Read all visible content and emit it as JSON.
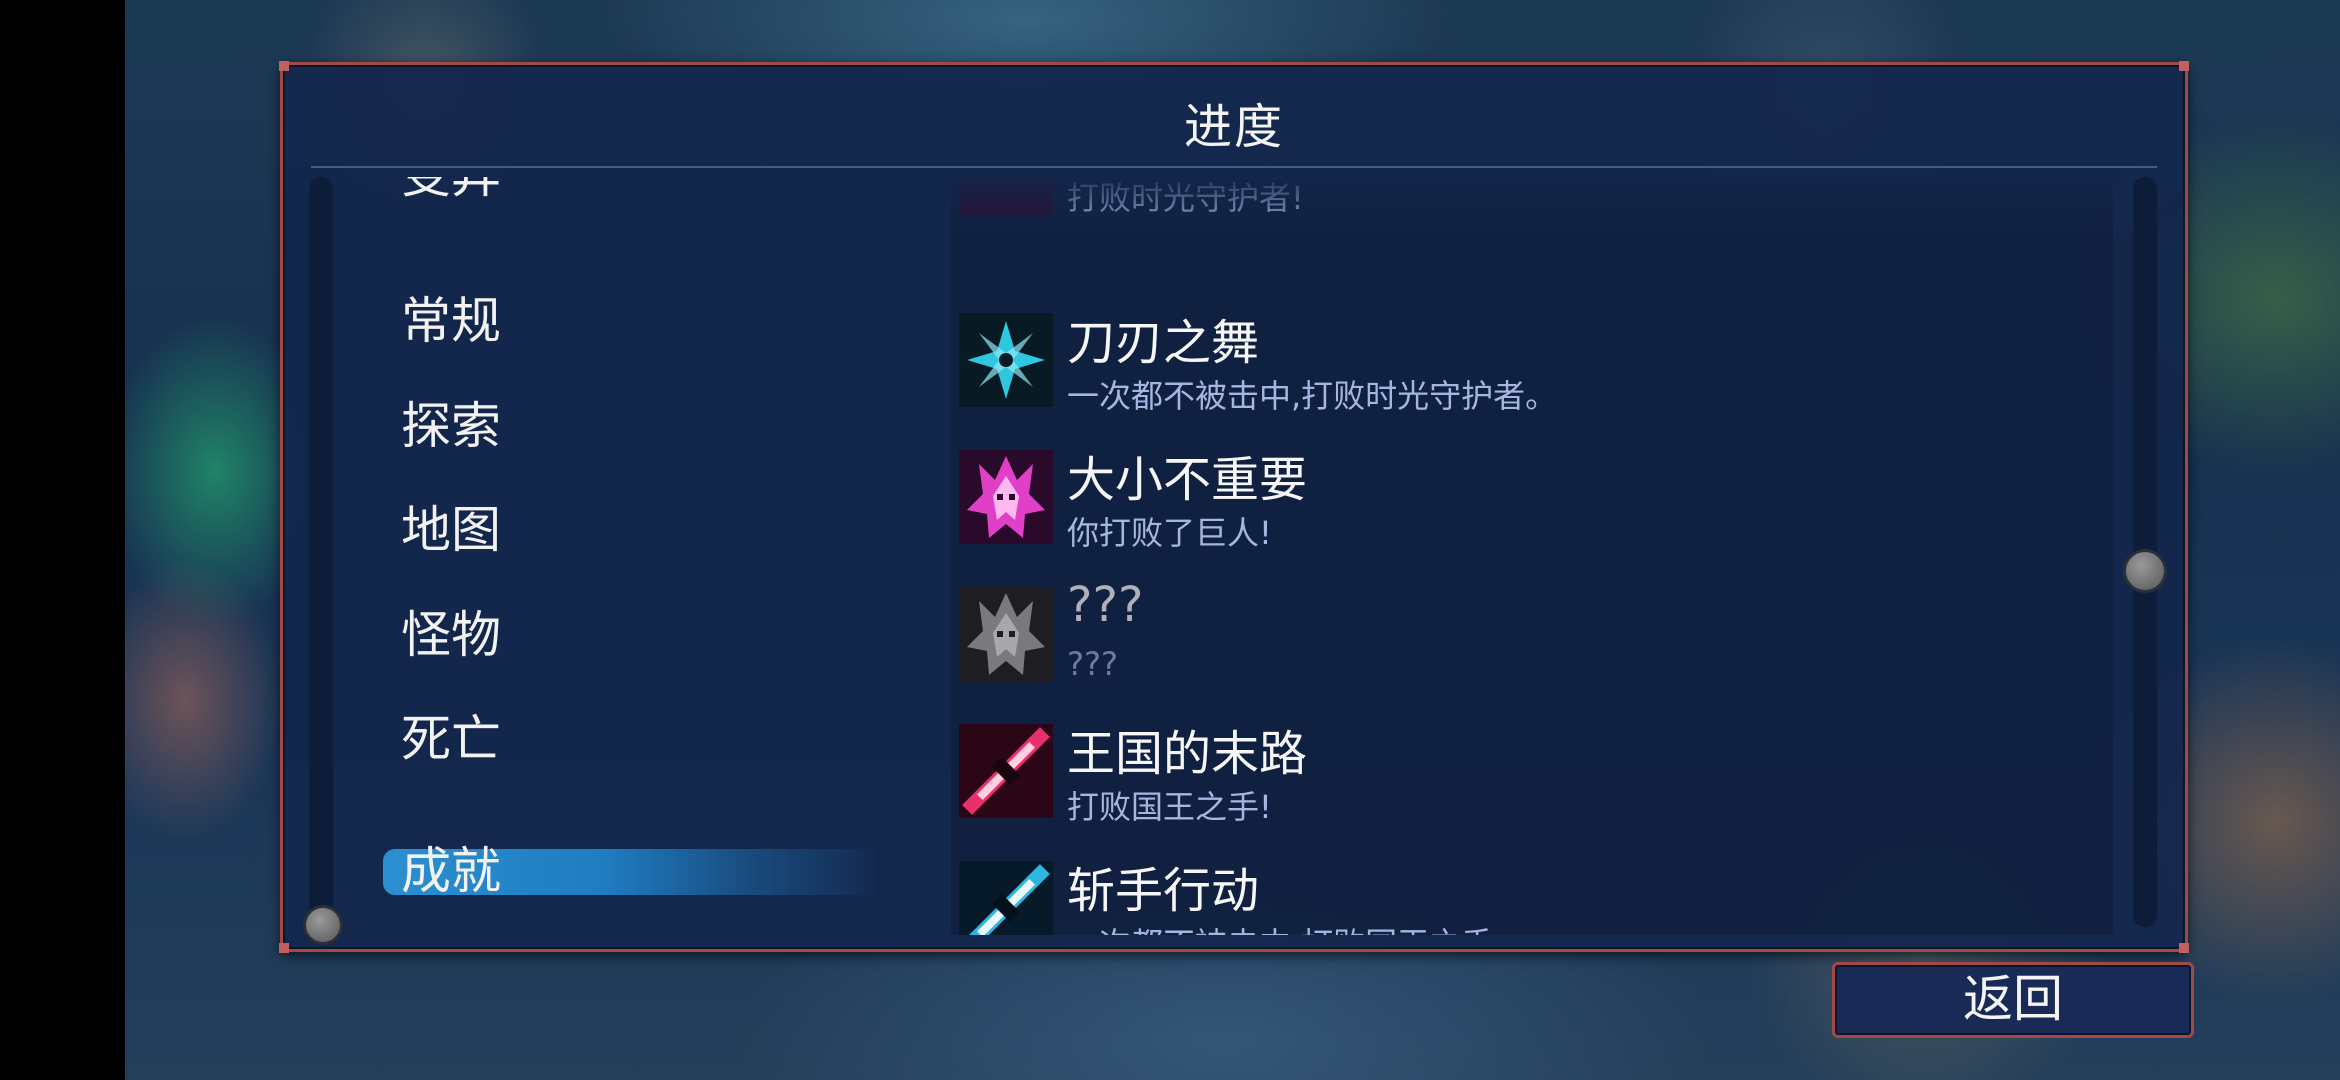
{
  "panel": {
    "title": "进度"
  },
  "categories": {
    "partial_top": "变异",
    "items": [
      "常规",
      "探索",
      "地图",
      "怪物",
      "死亡"
    ],
    "selected": "成就"
  },
  "achievements": {
    "partial_top_desc": "打败时光守护者!",
    "items": [
      {
        "name": "刀刃之舞",
        "desc": "一次都不被击中,打败时光守护者。",
        "icon": "shuriken-icon",
        "color": "#2fc6e0",
        "locked": false
      },
      {
        "name": "大小不重要",
        "desc": "你打败了巨人!",
        "icon": "giant-icon",
        "color": "#e040c8",
        "locked": false
      },
      {
        "name": "???",
        "desc": "???",
        "icon": "giant-locked-icon",
        "color": "#8a8a8a",
        "locked": true
      },
      {
        "name": "王国的末路",
        "desc": "打败国王之手!",
        "icon": "hand-sword-icon",
        "color": "#e8306a",
        "locked": false
      },
      {
        "name": "斩手行动",
        "desc": "一次都不被击中,打败国王之手。",
        "icon": "hand-sword-nohit-icon",
        "color": "#2fb6e0",
        "locked": false
      }
    ]
  },
  "back_button": {
    "label": "返回"
  },
  "colors": {
    "panel_border": "#a04a48",
    "panel_bg": "#13264b",
    "selected_bar": "#2b8fd0"
  }
}
